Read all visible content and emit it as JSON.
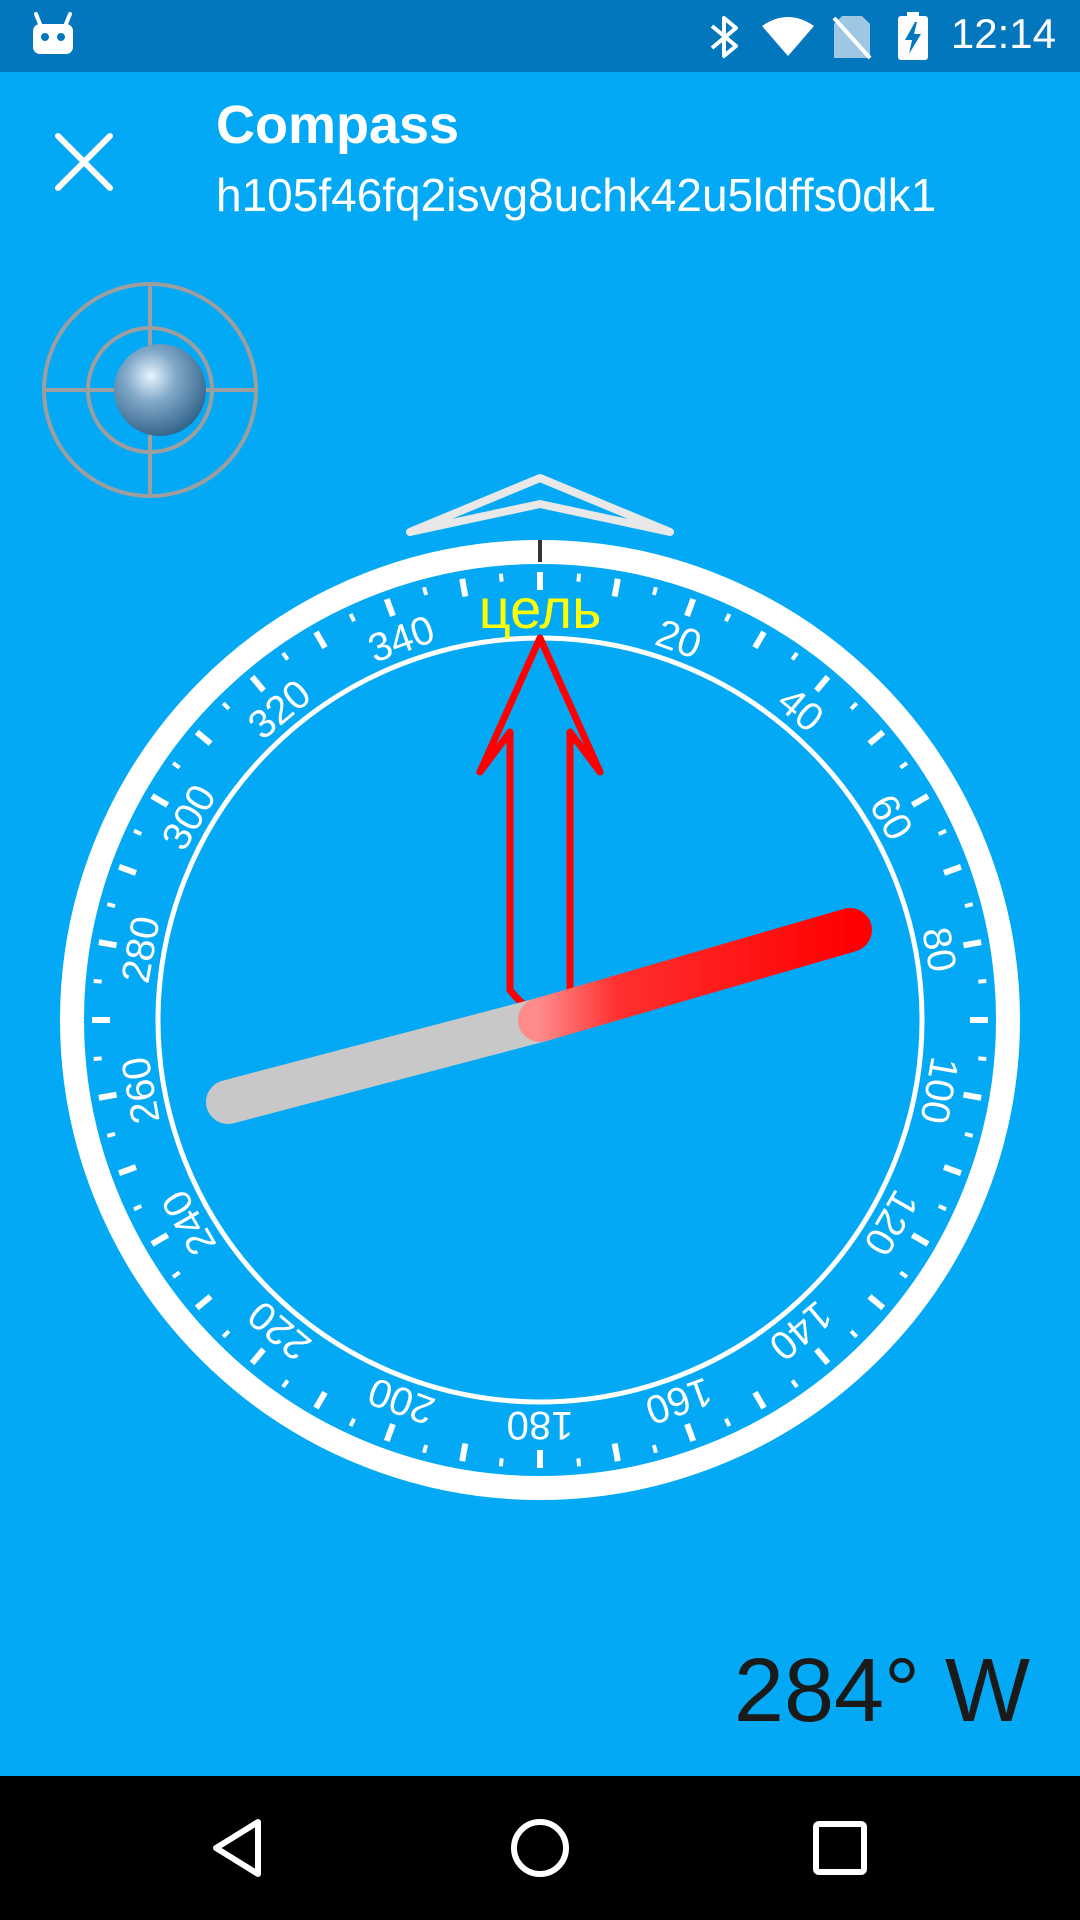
{
  "status_bar": {
    "time": "12:14",
    "icons": [
      "android-icon",
      "bluetooth-icon",
      "wifi-icon",
      "no-sim-icon",
      "battery-charging-icon"
    ]
  },
  "app_bar": {
    "close_icon": "close-icon",
    "title": "Compass",
    "subtitle": "h105f46fq2isvg8uchk42u5ldffs0dk1"
  },
  "compass": {
    "target_label": "цель",
    "dial_labels": [
      "20",
      "40",
      "60",
      "80",
      "100",
      "120",
      "140",
      "160",
      "180",
      "200",
      "220",
      "240",
      "260",
      "280",
      "300",
      "320",
      "340"
    ],
    "heading_degrees": 284,
    "colors": {
      "background": "#03A9F4",
      "dial": "#ffffff",
      "target_label": "#FFFF00",
      "north_needle": "#FF0000",
      "south_needle": "#C8C8C8",
      "target_arrow": "#FF0000"
    }
  },
  "heading": {
    "readout": "284° W"
  },
  "nav_bar": {
    "icons": [
      "back-icon",
      "home-icon",
      "recents-icon"
    ]
  }
}
